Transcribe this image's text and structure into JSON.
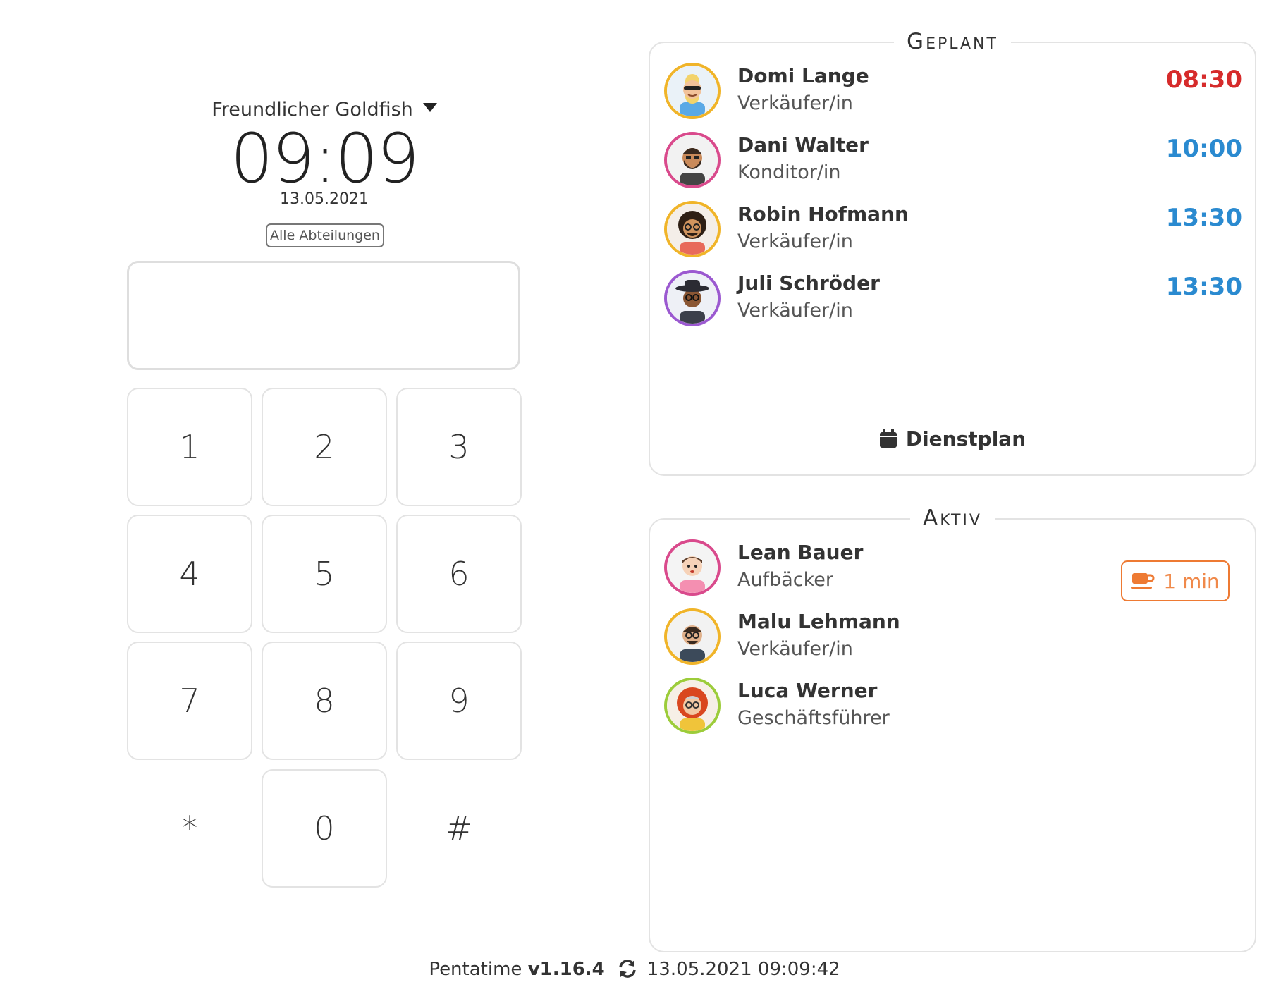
{
  "header": {
    "location": "Freundlicher Goldfish",
    "time": "09:09",
    "date": "13.05.2021",
    "department_button": "Alle Abteilungen"
  },
  "pin_display": {
    "value": ""
  },
  "keypad": {
    "k1": "1",
    "k2": "2",
    "k3": "3",
    "k4": "4",
    "k5": "5",
    "k6": "6",
    "k7": "7",
    "k8": "8",
    "k9": "9",
    "kstar": "*",
    "k0": "0",
    "khash": "#"
  },
  "geplant": {
    "title": "Geplant",
    "people": [
      {
        "name": "Domi Lange",
        "role": "Verkäufer/in",
        "time": "08:30",
        "time_color": "#d62b2b",
        "ring_color": "#f0b429"
      },
      {
        "name": "Dani Walter",
        "role": "Konditor/in",
        "time": "10:00",
        "time_color": "#2a8ad0",
        "ring_color": "#d94a8c"
      },
      {
        "name": "Robin Hofmann",
        "role": "Verkäufer/in",
        "time": "13:30",
        "time_color": "#2a8ad0",
        "ring_color": "#f0b429"
      },
      {
        "name": "Juli Schröder",
        "role": "Verkäufer/in",
        "time": "13:30",
        "time_color": "#2a8ad0",
        "ring_color": "#9b59d0"
      }
    ],
    "dienstplan_label": "Dienstplan"
  },
  "aktiv": {
    "title": "Aktiv",
    "people": [
      {
        "name": "Lean Bauer",
        "role": "Aufbäcker",
        "ring_color": "#d94a8c",
        "break": "1 min"
      },
      {
        "name": "Malu Lehmann",
        "role": "Verkäufer/in",
        "ring_color": "#f0b429"
      },
      {
        "name": "Luca Werner",
        "role": "Geschäftsführer",
        "ring_color": "#9ccc3a"
      }
    ]
  },
  "footer": {
    "app": "Pentatime",
    "version": "v1.16.4",
    "timestamp": "13.05.2021 09:09:42"
  },
  "colors": {
    "accent_blue": "#2a8ad0",
    "late_red": "#d62b2b",
    "break_orange": "#ee7a33"
  },
  "icons": {
    "location_dropdown": "caret-down-icon",
    "schedule": "calendar-icon",
    "break": "coffee-cup-icon",
    "sync": "sync-icon"
  }
}
